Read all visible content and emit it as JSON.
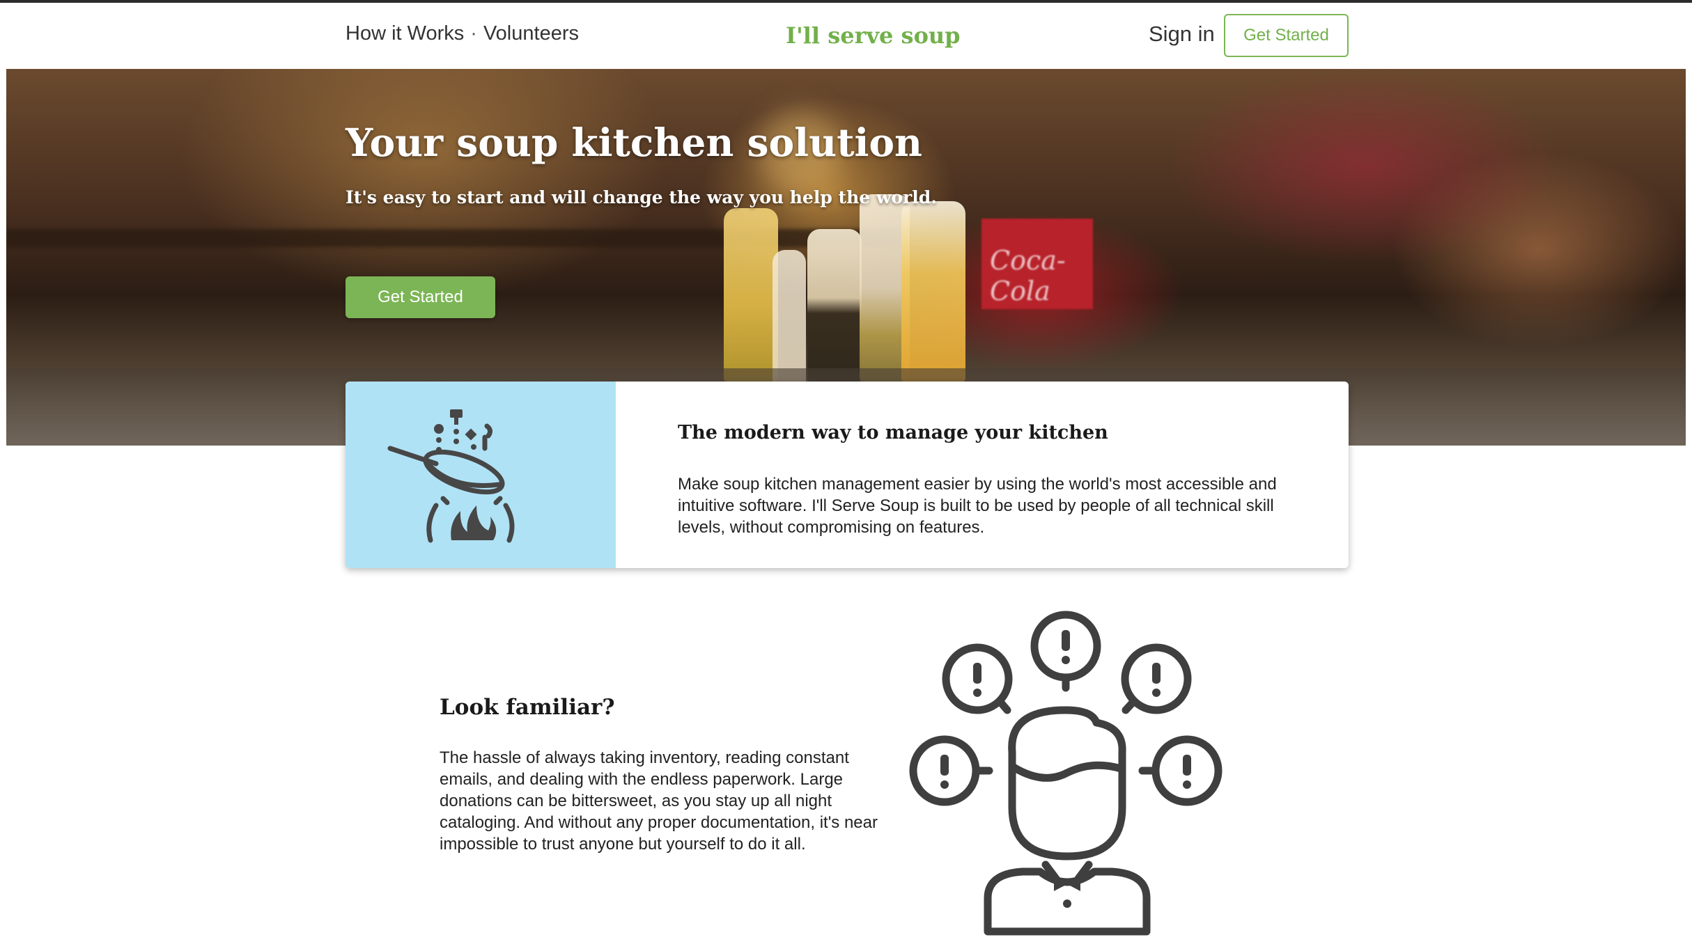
{
  "header": {
    "nav": [
      {
        "label": "How it Works"
      },
      {
        "label": "Volunteers"
      }
    ],
    "nav_separator": "·",
    "brand": "I'll serve soup",
    "signin_label": "Sign in",
    "cta_label": "Get Started"
  },
  "hero": {
    "title": "Your soup kitchen solution",
    "subtitle": "It's easy to start and will change the way you help the world.",
    "cta_label": "Get Started",
    "sign_text": "Coca-Cola"
  },
  "feature_card": {
    "icon": "frying-pan-icon",
    "title": "The modern way to manage your kitchen",
    "body": "Make soup kitchen management easier by using the world's most accessible and intuitive software. I'll Serve Soup is built to be used by people of all technical skill levels, without compromising on features."
  },
  "familiar": {
    "icon": "stressed-person-icon",
    "title": "Look familiar?",
    "body": "The hassle of always taking inventory, reading constant emails, and dealing with the endless paperwork. Large donations can be bittersweet, as you stay up all night cataloging. And without any proper documentation, it's near impossible to trust anyone but yourself to do it all."
  },
  "colors": {
    "accent": "#7cb555",
    "card_media_bg": "#b0e2f5",
    "icon_color": "#3f3f3f"
  }
}
